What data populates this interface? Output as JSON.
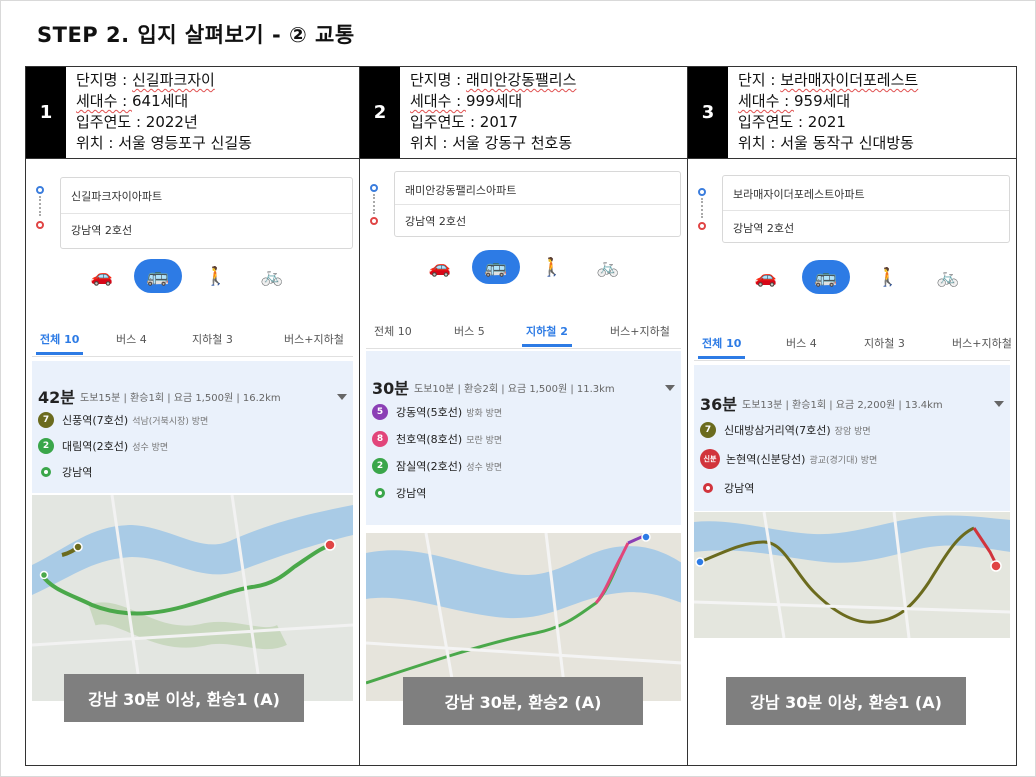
{
  "slide": {
    "title": "STEP 2. 입지 살펴보기 - ② 교통"
  },
  "complexes": [
    {
      "num": "1",
      "name_label": "단지명 : ",
      "name": "신길파크자이",
      "units_label": "세대수 : ",
      "units": "641세대",
      "year_label": "입주연도 : ",
      "year": "2022년",
      "location_label": "위치 : ",
      "location": "서울 영등포구 신길동",
      "origin": "신길파크자이아파트",
      "destination": "강남역 2호선",
      "tabs": [
        "전체 10",
        "버스 4",
        "지하철 3",
        "버스+지하철"
      ],
      "active_tab": 0,
      "time": "42분",
      "meta": "도보15분 | 환승1회 | 요금 1,500원 | 16.2km",
      "stops": [
        {
          "badge": "7",
          "color": "#6b6b1e",
          "name": "신풍역(7호선)",
          "sub": "석남(거북시장) 방면"
        },
        {
          "badge": "2",
          "color": "#3aa64a",
          "name": "대림역(2호선)",
          "sub": "성수 방면"
        },
        {
          "badge": "",
          "color": "end",
          "name": "강남역",
          "sub": ""
        }
      ],
      "caption": "강남 30분 이상, 환승1 (A)"
    },
    {
      "num": "2",
      "name_label": "단지명 : ",
      "name": "래미안강동팰리스",
      "units_label": "세대수 : ",
      "units": "999세대",
      "year_label": "입주연도 : ",
      "year": "2017",
      "location_label": "위치 : ",
      "location": "서울 강동구 천호동",
      "origin": "래미안강동팰리스아파트",
      "destination": "강남역 2호선",
      "tabs": [
        "전체 10",
        "버스 5",
        "지하철 2",
        "버스+지하철"
      ],
      "active_tab": 2,
      "time": "30분",
      "meta": "도보10분 | 환승2회 | 요금 1,500원 | 11.3km",
      "stops": [
        {
          "badge": "5",
          "color": "#8b3fb5",
          "name": "강동역(5호선)",
          "sub": "방화 방면"
        },
        {
          "badge": "8",
          "color": "#e2457a",
          "name": "천호역(8호선)",
          "sub": "모란 방면"
        },
        {
          "badge": "2",
          "color": "#3aa64a",
          "name": "잠실역(2호선)",
          "sub": "성수 방면"
        },
        {
          "badge": "",
          "color": "end",
          "name": "강남역",
          "sub": ""
        }
      ],
      "caption": "강남 30분, 환승2 (A)"
    },
    {
      "num": "3",
      "name_label": "단지 : ",
      "name": "보라매자이더포레스트",
      "units_label": "세대수 : ",
      "units": "959세대",
      "year_label": "입주연도 : ",
      "year": "2021",
      "location_label": "위치 : ",
      "location": "서울 동작구 신대방동",
      "origin": "보라매자이더포레스트아파트",
      "destination": "강남역 2호선",
      "tabs": [
        "전체 10",
        "버스 4",
        "지하철 3",
        "버스+지하철"
      ],
      "active_tab": 0,
      "time": "36분",
      "meta": "도보13분 | 환승1회 | 요금 2,200원 | 13.4km",
      "stops": [
        {
          "badge": "7",
          "color": "#6b6b1e",
          "name": "신대방삼거리역(7호선)",
          "sub": "장암 방면"
        },
        {
          "badge": "신분",
          "color": "#d1343c",
          "name": "논현역(신분당선)",
          "sub": "광교(경기대) 방면"
        },
        {
          "badge": "",
          "color": "endred",
          "name": "강남역",
          "sub": ""
        }
      ],
      "caption": "강남 30분 이상, 환승1 (A)"
    }
  ],
  "icons": {
    "car": "car-icon",
    "bus": "bus-icon",
    "walk": "walk-icon",
    "bike": "bike-icon"
  },
  "colors": {
    "accent": "#2d7be5",
    "line2": "#3aa64a",
    "line7": "#6b6b1e",
    "caption_bg": "#7f7f7f"
  }
}
